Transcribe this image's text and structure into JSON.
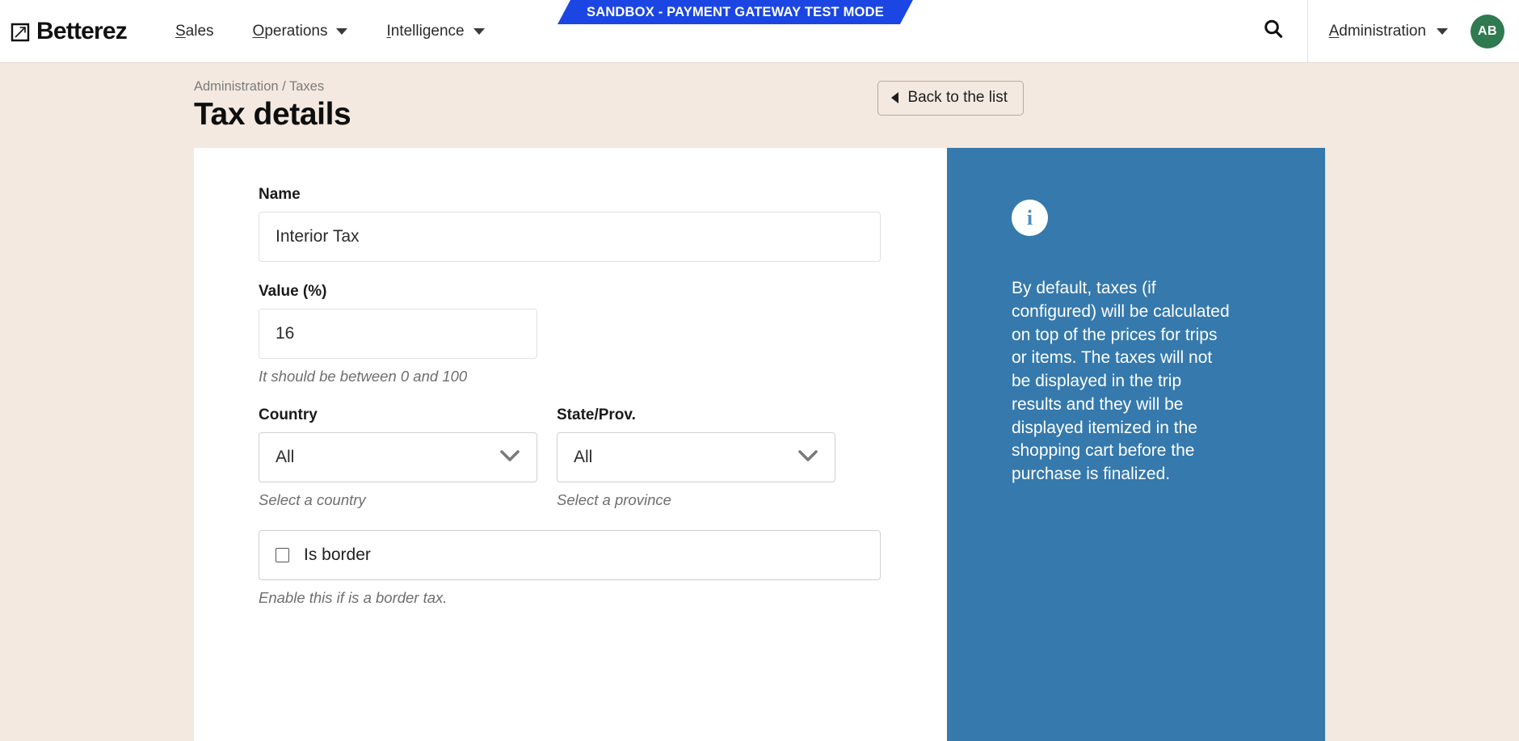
{
  "header": {
    "brand_name": "Betterez",
    "brand_mark_icon": "arrow-up-right-square-logo",
    "nav": [
      {
        "label": "Sales",
        "accel": "S",
        "rest": "ales",
        "has_caret": false
      },
      {
        "label": "Operations",
        "accel": "O",
        "rest": "perations",
        "has_caret": true
      },
      {
        "label": "Intelligence",
        "accel": "I",
        "rest": "ntelligence",
        "has_caret": true
      }
    ],
    "sandbox_banner": "SANDBOX - PAYMENT GATEWAY TEST MODE",
    "sandbox_color": "#1b46e4",
    "search_icon": "search-icon",
    "admin_label": "Administration",
    "admin_accel": "A",
    "admin_rest": "dministration",
    "avatar_initials": "AB",
    "avatar_color": "#2f7a50"
  },
  "page": {
    "breadcrumb": "Administration / Taxes",
    "title": "Tax details",
    "back_button": "Back to the list",
    "back_icon": "caret-left-icon",
    "background_color": "#f3e9e0"
  },
  "form": {
    "name": {
      "label": "Name",
      "value": "Interior Tax",
      "placeholder": ""
    },
    "value_percent": {
      "label": "Value (%)",
      "value": "16",
      "placeholder": "",
      "hint": "It should be between 0 and 100"
    },
    "country": {
      "label": "Country",
      "selected": "All",
      "hint": "Select a country",
      "chevron_icon": "chevron-down-icon"
    },
    "state_prov": {
      "label": "State/Prov.",
      "selected": "All",
      "hint": "Select a province",
      "chevron_icon": "chevron-down-icon"
    },
    "is_border": {
      "label": "Is border",
      "checked": false,
      "hint": "Enable this if is a border tax."
    }
  },
  "info_panel": {
    "icon": "info-circle-icon",
    "icon_glyph": "i",
    "background_color": "#3579ad",
    "text": "By default, taxes (if configured) will be calculated on top of the prices for trips or items. The taxes will not be displayed in the trip results and they will be displayed itemized in the shopping cart before the purchase is finalized."
  }
}
